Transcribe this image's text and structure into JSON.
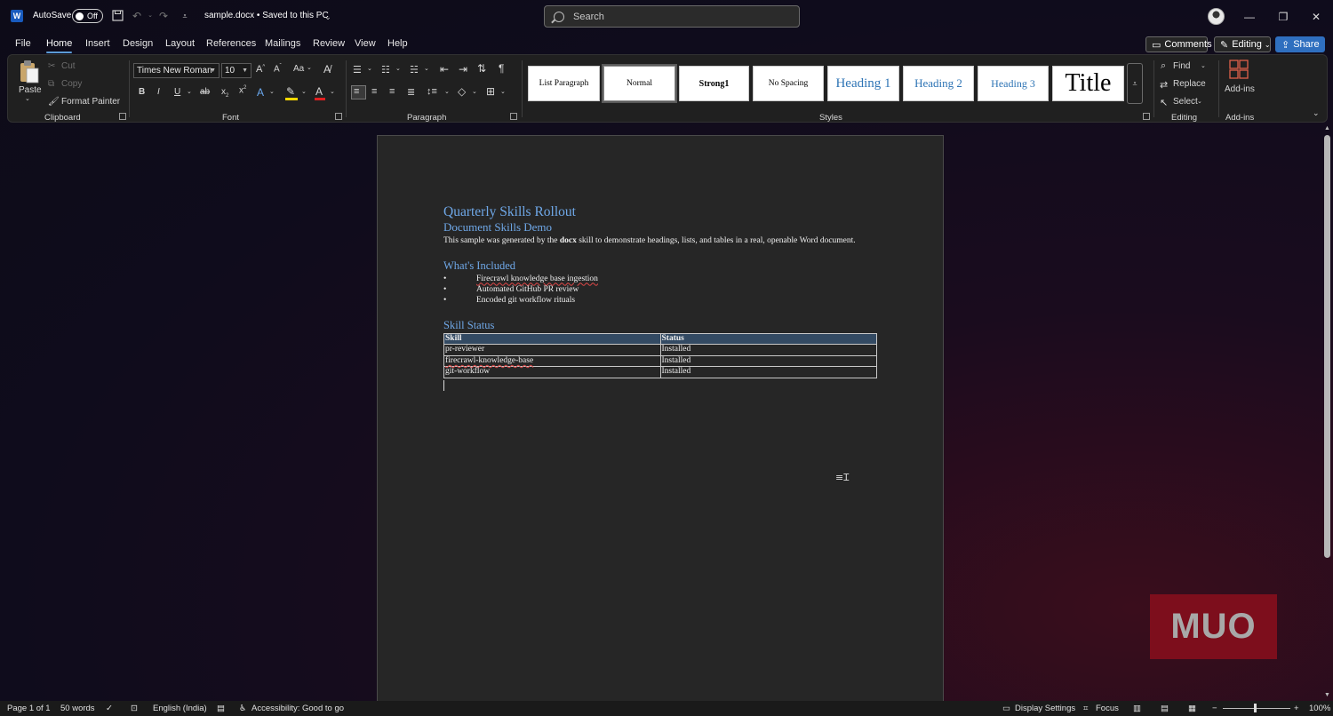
{
  "titlebar": {
    "autosave_label": "AutoSave",
    "autosave_state": "Off",
    "doc_title": "sample.docx • Saved to this PC",
    "search_placeholder": "Search"
  },
  "tabs": [
    "File",
    "Home",
    "Insert",
    "Design",
    "Layout",
    "References",
    "Mailings",
    "Review",
    "View",
    "Help"
  ],
  "active_tab": "Home",
  "top_buttons": {
    "comments": "Comments",
    "editing": "Editing",
    "share": "Share"
  },
  "ribbon": {
    "clipboard": {
      "label": "Clipboard",
      "paste": "Paste",
      "cut": "Cut",
      "copy": "Copy",
      "format_painter": "Format Painter"
    },
    "font": {
      "label": "Font",
      "font_name": "Times New Roman",
      "font_size": "10",
      "bold": "B",
      "italic": "I",
      "underline": "U",
      "change_case": "Aa",
      "highlight_color": "#ffd800",
      "font_color": "#e02020"
    },
    "paragraph": {
      "label": "Paragraph"
    },
    "styles": {
      "label": "Styles",
      "items": [
        "List Paragraph",
        "Normal",
        "Strong1",
        "No Spacing",
        "Heading 1",
        "Heading 2",
        "Heading 3",
        "Title"
      ],
      "selected": "Normal"
    },
    "editing": {
      "label": "Editing",
      "find": "Find",
      "replace": "Replace",
      "select": "Select"
    },
    "addins": {
      "label": "Add-ins",
      "button": "Add-ins"
    }
  },
  "document": {
    "title": "Quarterly Skills Rollout",
    "subtitle": "Document Skills Demo",
    "intro_before": "This sample was generated by the ",
    "intro_bold": "docx",
    "intro_after": " skill to demonstrate headings, lists, and tables in a real, openable Word document.",
    "section1": "What's Included",
    "bullets": [
      "Firecrawl knowledge base ingestion",
      "Automated GitHub PR review",
      "Encoded git workflow rituals"
    ],
    "section2": "Skill Status",
    "table": {
      "headers": [
        "Skill",
        "Status"
      ],
      "rows": [
        [
          "pr-reviewer",
          "Installed"
        ],
        [
          "firecrawl-knowledge-base",
          "Installed"
        ],
        [
          "git-workflow",
          "Installed"
        ]
      ]
    }
  },
  "watermark": "MUO",
  "statusbar": {
    "page": "Page 1 of 1",
    "words": "50 words",
    "language": "English (India)",
    "accessibility": "Accessibility: Good to go",
    "display_settings": "Display Settings",
    "focus": "Focus",
    "zoom": "100%"
  }
}
